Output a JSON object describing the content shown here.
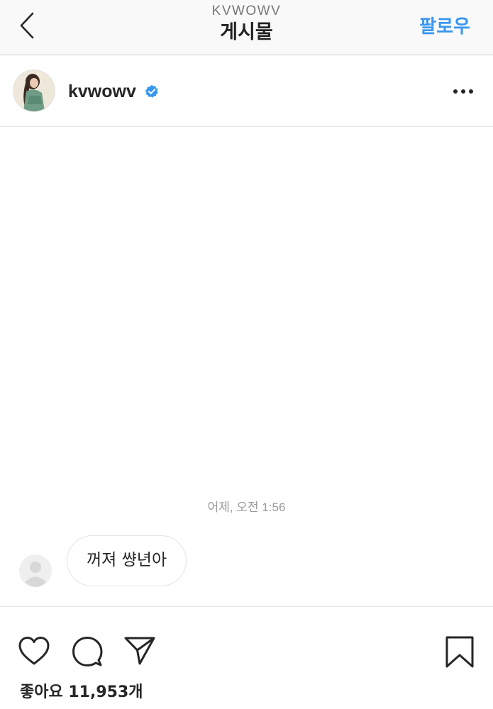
{
  "header": {
    "username": "KVWOWV",
    "title": "게시물",
    "follow_label": "팔로우"
  },
  "post": {
    "author": "kvwowv",
    "verified": true
  },
  "chat": {
    "timestamp": "어제, 오전 1:56",
    "message": "꺼져 썅년아"
  },
  "likes": {
    "text": "좋아요 11,953개"
  },
  "icons": {
    "back": "chevron-left-icon",
    "verified": "verified-badge-icon",
    "more": "more-dots-icon",
    "like": "heart-icon",
    "comment": "comment-icon",
    "share": "send-icon",
    "save": "bookmark-icon"
  },
  "colors": {
    "accent": "#3897f0",
    "text": "#262626",
    "muted": "#9a9a9a"
  }
}
